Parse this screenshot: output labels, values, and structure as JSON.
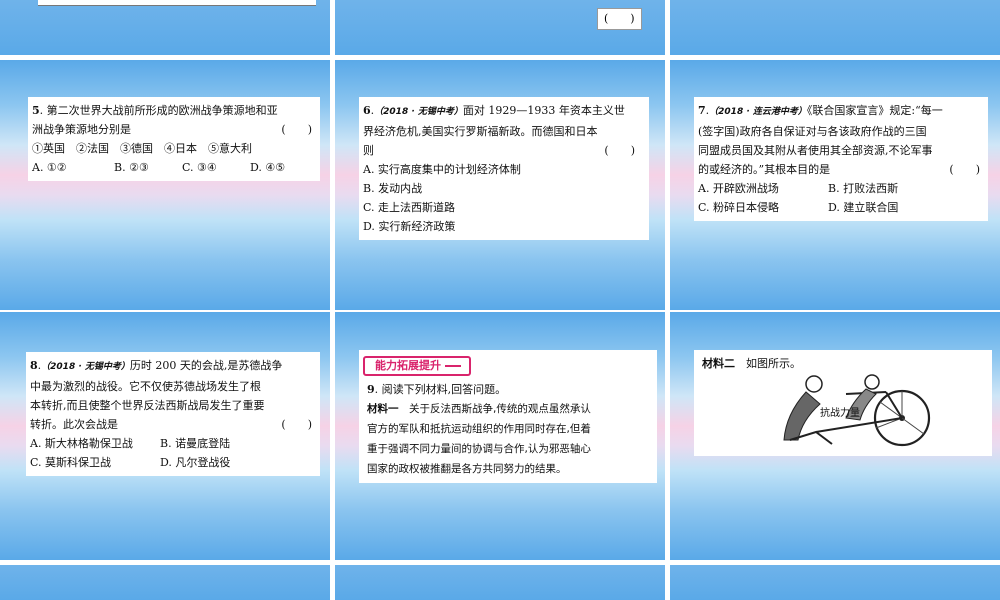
{
  "top_right_paren": "(　　)",
  "q5": {
    "num": "5",
    "text_line1": "第二次世界大战前所形成的欧洲战争策源地和亚",
    "text_line2": "洲战争策源地分别是",
    "paren": "(　　)",
    "items": "①英国　②法国　③德国　④日本　⑤意大利",
    "options": [
      "A. ①②",
      "B. ②③",
      "C. ③④",
      "D. ④⑤"
    ]
  },
  "q6": {
    "num": "6",
    "source": "（2018 · 无锡中考）",
    "text_line1": "面对 1929—1933 年资本主义世",
    "text_line2": "界经济危机,美国实行罗斯福新政。而德国和日本",
    "text_line3": "则",
    "paren": "(　　)",
    "options": [
      "A. 实行高度集中的计划经济体制",
      "B. 发动内战",
      "C. 走上法西斯道路",
      "D. 实行新经济政策"
    ]
  },
  "q7": {
    "num": "7",
    "source": "（2018 · 连云港中考）",
    "text_line1": "《联合国家宣言》规定:“每一",
    "text_line2": "(签字国)政府各自保证对与各该政府作战的三国",
    "text_line3": "同盟成员国及其附从者使用其全部资源,不论军事",
    "text_line4": "的或经济的。”其根本目的是",
    "paren": "(　　)",
    "options": [
      "A. 开辟欧洲战场",
      "B. 打败法西斯",
      "C. 粉碎日本侵略",
      "D. 建立联合国"
    ]
  },
  "q8": {
    "num": "8",
    "source": "（2018 · 无锡中考）",
    "text_line1": "历时 200 天的会战,是苏德战争",
    "text_line2": "中最为激烈的战役。它不仅使苏德战场发生了根",
    "text_line3": "本转折,而且使整个世界反法西斯战局发生了重要",
    "text_line4": "转折。此次会战是",
    "paren": "(　　)",
    "options": [
      "A. 斯大林格勒保卫战",
      "B. 诺曼底登陆",
      "C. 莫斯科保卫战",
      "D. 凡尔登战役"
    ]
  },
  "q9": {
    "banner": "能力拓展提升",
    "num": "9",
    "intro": "阅读下列材料,回答问题。",
    "material1_label": "材料一",
    "material1_lines": [
      "关于反法西斯战争,传统的观点虽然承认",
      "官方的军队和抵抗运动组织的作用同时存在,但着",
      "重于强调不同力量间的协调与合作,认为邪恶轴心",
      "国家的政权被推翻是各方共同努力的结果。"
    ]
  },
  "material2": {
    "label": "材料二",
    "text": "如图所示。",
    "image_caption": "抗战力量"
  }
}
